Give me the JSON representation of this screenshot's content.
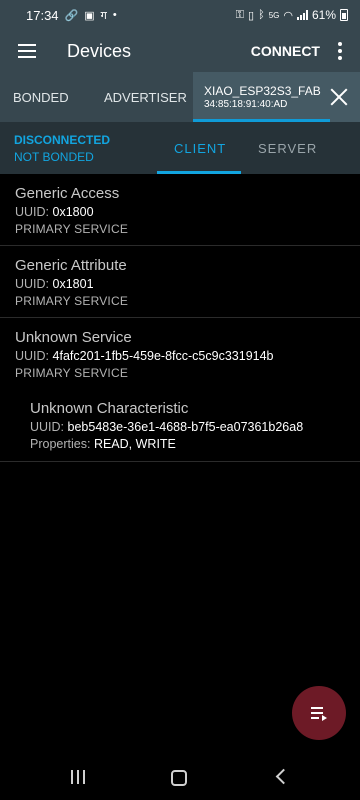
{
  "status_bar": {
    "time": "17:34",
    "left_icons": [
      "link-icon",
      "image-icon",
      "translate-icon",
      "dot-icon"
    ],
    "right_icons": [
      "key-icon",
      "vibrate-icon",
      "bluetooth-icon",
      "wifi-icon",
      "signal-icon"
    ],
    "network_label": "5G",
    "battery": "61%"
  },
  "app_bar": {
    "title": "Devices",
    "connect_label": "CONNECT"
  },
  "tabs": {
    "bonded": "BONDED",
    "advertiser": "ADVERTISER",
    "device_name": "XIAO_ESP32S3_FAB",
    "device_address": "34:85:18:91:40:AD"
  },
  "connection": {
    "status": "DISCONNECTED",
    "bond_status": "NOT BONDED",
    "client_tab": "CLIENT",
    "server_tab": "SERVER"
  },
  "labels": {
    "uuid": "UUID:",
    "properties": "Properties:"
  },
  "services": [
    {
      "name": "Generic Access",
      "uuid": "0x1800",
      "type": "PRIMARY SERVICE"
    },
    {
      "name": "Generic Attribute",
      "uuid": "0x1801",
      "type": "PRIMARY SERVICE"
    },
    {
      "name": "Unknown Service",
      "uuid": "4fafc201-1fb5-459e-8fcc-c5c9c331914b",
      "type": "PRIMARY SERVICE"
    }
  ],
  "characteristic": {
    "name": "Unknown Characteristic",
    "uuid": "beb5483e-36e1-4688-b7f5-ea07361b26a8",
    "properties": "READ, WRITE"
  },
  "colors": {
    "toolbar": "#37474f",
    "accent": "#12a5e0",
    "fab": "#6d1a26",
    "background": "#000000"
  },
  "fab": {
    "icon": "log-list-icon"
  },
  "nav": {
    "icons": [
      "recent-apps-icon",
      "home-icon",
      "back-icon"
    ]
  }
}
